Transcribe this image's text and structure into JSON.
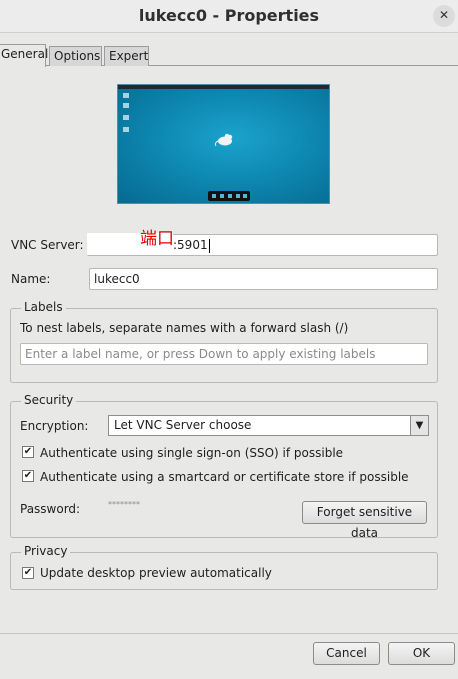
{
  "window": {
    "title": "lukecc0 - Properties",
    "close_glyph": "✕"
  },
  "tabs": [
    {
      "label": "General",
      "active": true
    },
    {
      "label": "Options",
      "active": false
    },
    {
      "label": "Expert",
      "active": false
    }
  ],
  "preview": {
    "description_icons": [
      "mouse-icon"
    ]
  },
  "vnc_server": {
    "label": "VNC Server:",
    "value": ":5901"
  },
  "annotation": {
    "text": "端口",
    "color": "#e10000"
  },
  "name": {
    "label": "Name:",
    "value": "lukecc0"
  },
  "labels_group": {
    "title": "Labels",
    "hint": "To nest labels, separate names with a forward slash (/)",
    "placeholder": "Enter a label name, or press Down to apply existing labels"
  },
  "security": {
    "title": "Security",
    "encryption_label": "Encryption:",
    "encryption_value": "Let VNC Server choose",
    "sso_label": "Authenticate using single sign-on (SSO) if possible",
    "sso_checked": true,
    "smartcard_label": "Authenticate using a smartcard or certificate store if possible",
    "smartcard_checked": true,
    "password_label": "Password:",
    "password_value": "********",
    "forget_button": "Forget sensitive data"
  },
  "privacy": {
    "title": "Privacy",
    "update_preview_label": "Update desktop preview automatically",
    "update_preview_checked": true
  },
  "footer": {
    "cancel": "Cancel",
    "ok": "OK"
  },
  "check_glyph": "✔"
}
